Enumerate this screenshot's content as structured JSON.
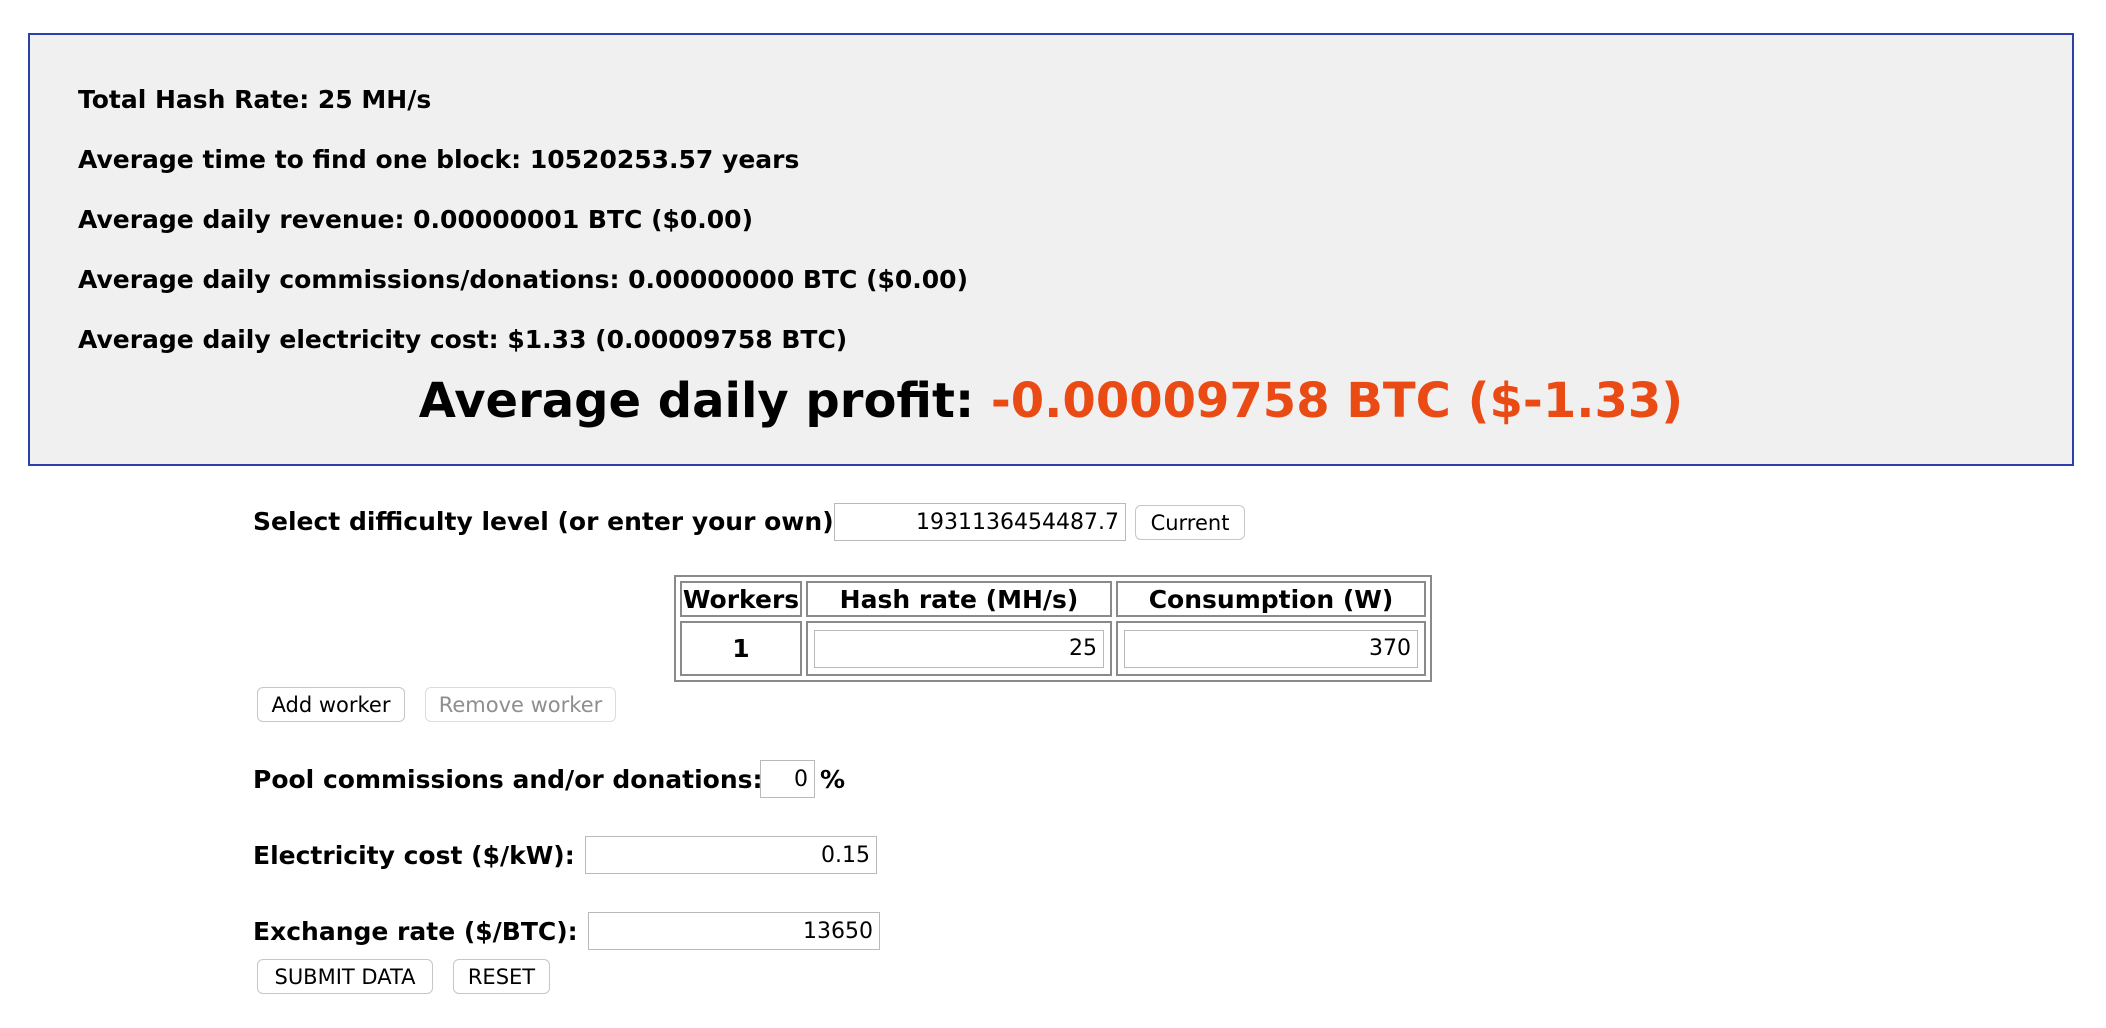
{
  "summary": {
    "total_hash_rate": "Total Hash Rate: 25 MH/s",
    "avg_time_block": "Average time to find one block: 10520253.57 years",
    "avg_daily_revenue": "Average daily revenue: 0.00000001 BTC ($0.00)",
    "avg_daily_commissions": "Average daily commissions/donations: 0.00000000 BTC ($0.00)",
    "avg_daily_electricity": "Average daily electricity cost: $1.33 (0.00009758 BTC)",
    "profit_label": "Average daily profit: ",
    "profit_value": "-0.00009758 BTC ($-1.33)",
    "profit_color": "#ea4a14"
  },
  "difficulty": {
    "label": "Select difficulty level (or enter your own):",
    "value": "1931136454487.7",
    "current_button": "Current"
  },
  "workers_table": {
    "headers": [
      "Workers",
      "Hash rate (MH/s)",
      "Consumption (W)"
    ],
    "rows": [
      {
        "worker": "1",
        "hash_rate": "25",
        "consumption": "370"
      }
    ]
  },
  "worker_buttons": {
    "add": "Add worker",
    "remove": "Remove worker"
  },
  "pool": {
    "label": "Pool commissions and/or donations:",
    "value": "0",
    "unit": "%"
  },
  "electricity": {
    "label": "Electricity cost ($/kW):",
    "value": "0.15"
  },
  "exchange": {
    "label": "Exchange rate ($/BTC):",
    "value": "13650"
  },
  "form_buttons": {
    "submit": "SUBMIT DATA",
    "reset": "RESET"
  }
}
